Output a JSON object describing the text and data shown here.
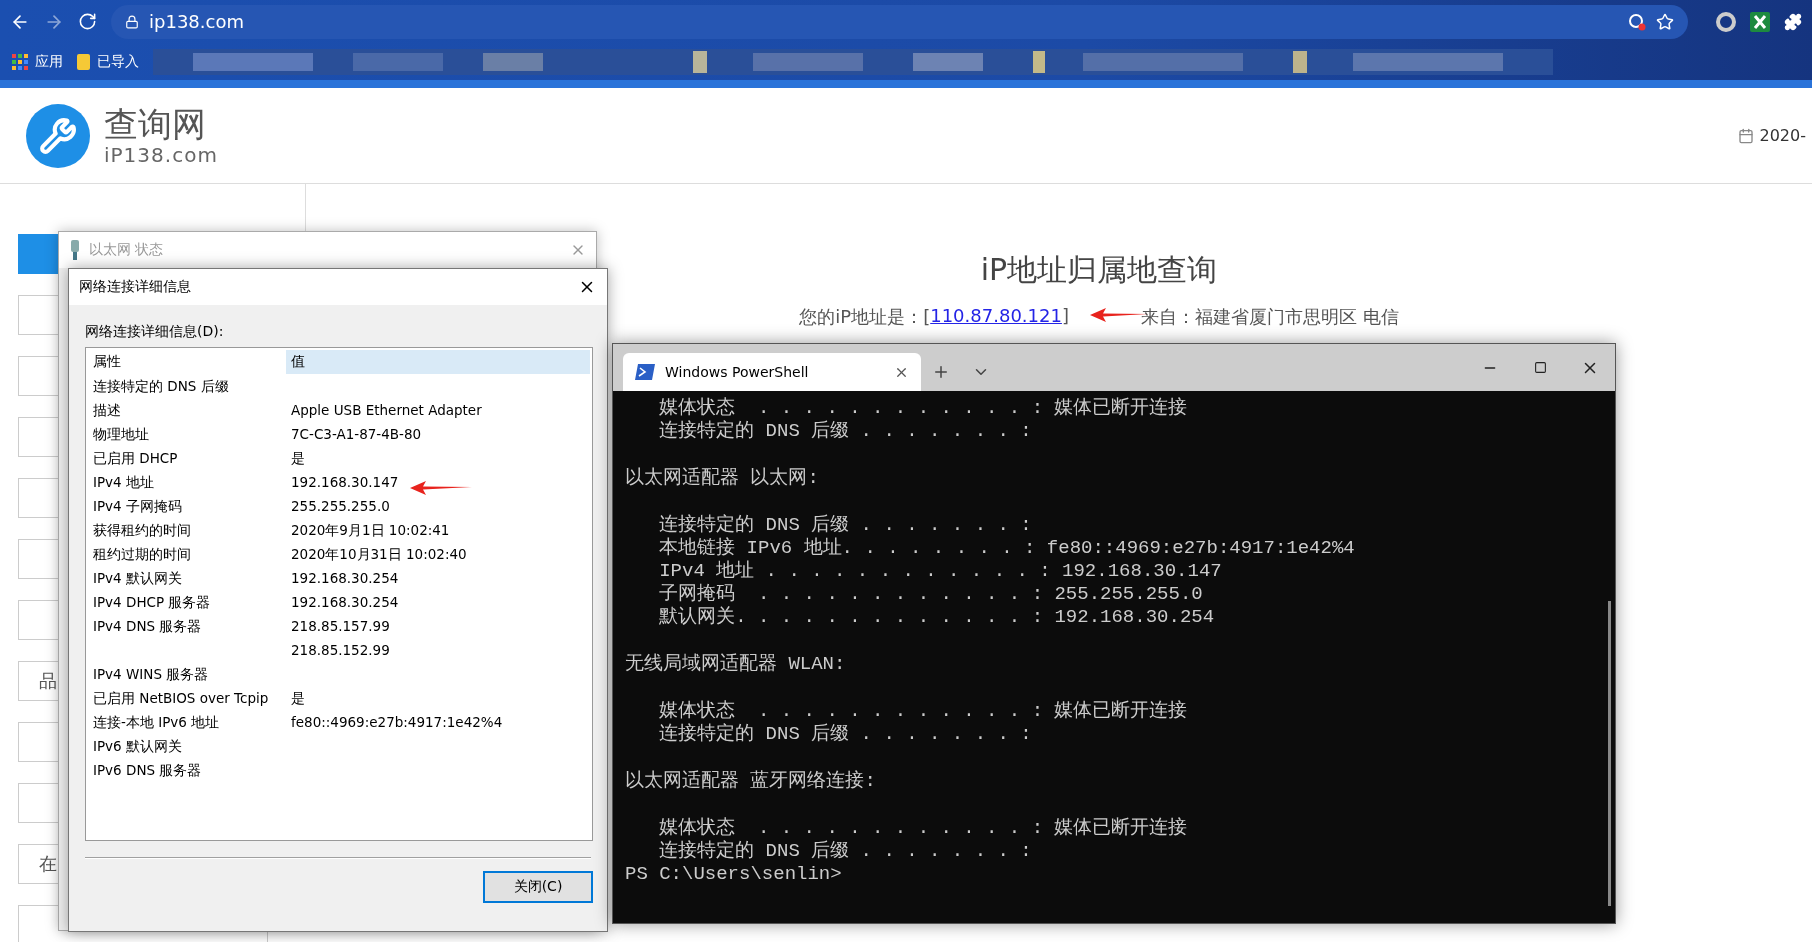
{
  "browser": {
    "url": "ip138.com",
    "bookmarks": [
      {
        "label": "应用",
        "kind": "apps"
      },
      {
        "label": "已导入",
        "kind": "folder"
      }
    ]
  },
  "site": {
    "logo_title": "查询网",
    "logo_subtitle": "iP138.com",
    "date": "2020-"
  },
  "sidebar": {
    "items": [
      {
        "selected": true
      },
      {
        "selected": false
      },
      {
        "selected": false
      },
      {
        "selected": false
      },
      {
        "selected": false
      },
      {
        "selected": false
      },
      {
        "selected": false
      },
      {
        "label": "品",
        "selected": false
      },
      {
        "selected": false
      },
      {
        "selected": false
      },
      {
        "label": "在",
        "selected": false
      },
      {
        "selected": false
      }
    ]
  },
  "main": {
    "title": "iP地址归属地查询",
    "ip_prefix": "您的iP地址是：[",
    "ip_link": "110.87.80.121",
    "ip_suffix": "]",
    "location": "来自：福建省厦门市思明区 电信"
  },
  "status_window": {
    "title": "以太网 状态",
    "active": false
  },
  "details_dialog": {
    "title": "网络连接详细信息",
    "list_label": "网络连接详细信息(D):",
    "columns": [
      "属性",
      "值"
    ],
    "rows": [
      {
        "property": "连接特定的 DNS 后缀"
      },
      {
        "property": "描述",
        "value": "Apple USB Ethernet Adapter"
      },
      {
        "property": "物理地址",
        "value": "7C-C3-A1-87-4B-80"
      },
      {
        "property": "已启用 DHCP",
        "value": "是"
      },
      {
        "property": "IPv4 地址",
        "value": "192.168.30.147"
      },
      {
        "property": "IPv4 子网掩码",
        "value": "255.255.255.0"
      },
      {
        "property": "获得租约的时间",
        "value": "2020年9月1日 10:02:41"
      },
      {
        "property": "租约过期的时间",
        "value": "2020年10月31日 10:02:40"
      },
      {
        "property": "IPv4 默认网关",
        "value": "192.168.30.254"
      },
      {
        "property": "IPv4 DHCP 服务器",
        "value": "192.168.30.254"
      },
      {
        "property": "IPv4 DNS 服务器",
        "value": "218.85.157.99"
      },
      {
        "value": "218.85.152.99"
      },
      {
        "property": "IPv4 WINS 服务器"
      },
      {
        "property": "已启用 NetBIOS over Tcpip",
        "value": "是"
      },
      {
        "property": "连接-本地 IPv6 地址",
        "value": "fe80::4969:e27b:4917:1e42%4"
      },
      {
        "property": "IPv6 默认网关"
      },
      {
        "property": "IPv6 DNS 服务器"
      }
    ],
    "button": "关闭(C)"
  },
  "terminal": {
    "tab_title": "Windows PowerShell",
    "blocks": [
      [
        "   媒体状态  . . . . . . . . . . . . : 媒体已断开连接",
        "   连接特定的 DNS 后缀 . . . . . . . :"
      ],
      [
        "以太网适配器 以太网:"
      ],
      [
        "   连接特定的 DNS 后缀 . . . . . . . :",
        "   本地链接 IPv6 地址. . . . . . . . : fe80::4969:e27b:4917:1e42%4",
        "   IPv4 地址 . . . . . . . . . . . . : 192.168.30.147",
        "   子网掩码  . . . . . . . . . . . . : 255.255.255.0",
        "   默认网关. . . . . . . . . . . . . : 192.168.30.254"
      ],
      [
        "无线局域网适配器 WLAN:"
      ],
      [
        "   媒体状态  . . . . . . . . . . . . : 媒体已断开连接",
        "   连接特定的 DNS 后缀 . . . . . . . :"
      ],
      [
        "以太网适配器 蓝牙网络连接:"
      ],
      [
        "   媒体状态  . . . . . . . . . . . . : 媒体已断开连接",
        "   连接特定的 DNS 后缀 . . . . . . . :",
        "PS C:\\Users\\senlin>"
      ]
    ]
  }
}
